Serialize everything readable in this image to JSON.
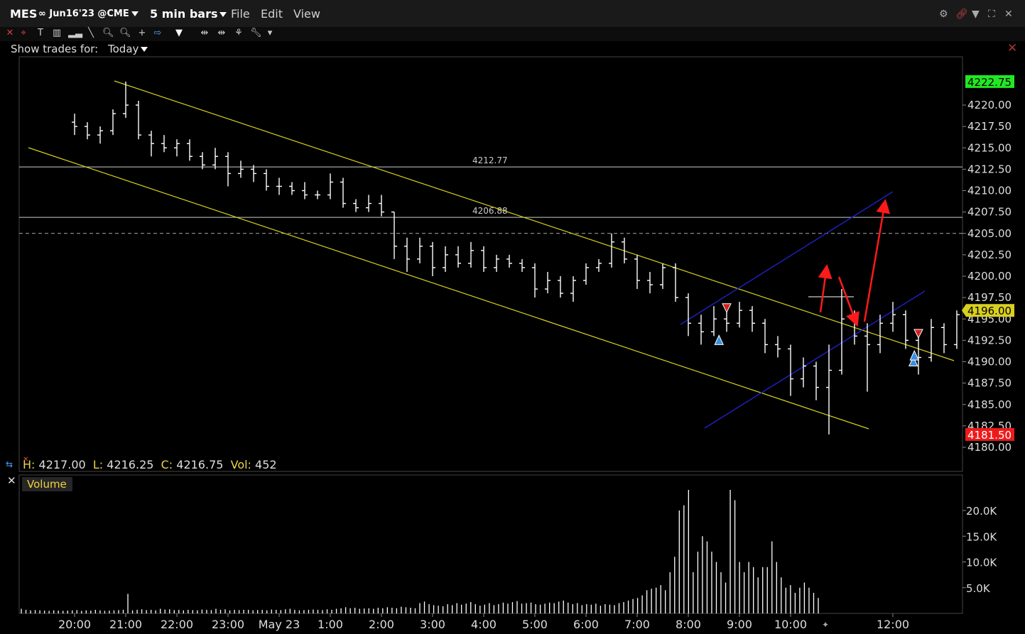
{
  "titlebar": {
    "symbol": "MES",
    "contract": "∞ Jun16'23 @CME",
    "timeframe": "5 min bars",
    "menus": [
      "File",
      "Edit",
      "View"
    ]
  },
  "trades_filter": {
    "label": "Show trades for:",
    "value": "Today"
  },
  "chart_data": [
    {
      "type": "bar",
      "title": "",
      "y_ticks": [
        "4220.00",
        "4217.50",
        "4215.00",
        "4212.50",
        "4210.00",
        "4207.50",
        "4205.00",
        "4202.50",
        "4200.00",
        "4197.50",
        "4195.00",
        "4192.50",
        "4190.00",
        "4187.50",
        "4185.00",
        "4182.50",
        "4180.00"
      ],
      "ylim": [
        4179,
        4224
      ],
      "x_ticks": [
        "20:00",
        "21:00",
        "22:00",
        "23:00",
        "May 23",
        "1:00",
        "2:00",
        "3:00",
        "4:00",
        "5:00",
        "6:00",
        "7:00",
        "8:00",
        "9:00",
        "10:00",
        "12:00"
      ],
      "price_markers": {
        "high": "4222.75",
        "last": "4196.00",
        "low": "4181.50"
      },
      "horizontal_levels": [
        {
          "label": "4212.77",
          "value": 4212.77
        },
        {
          "label": "4206.88",
          "value": 4206.88
        },
        {
          "label": "",
          "value": 4205.0,
          "style": "dashed"
        }
      ],
      "ohlc_readout": {
        "H": "4217.00",
        "L": "4216.25",
        "C": "4216.75",
        "Vol": "452"
      },
      "colors": {
        "bars": "#ffffff",
        "channel_upper": "#d8d020",
        "channel_blue": "#2020c8",
        "arrows": "#ff1a1a",
        "buy": "#3a8fe0",
        "sell": "#d02020",
        "high_bg": "#22e822",
        "low_bg": "#ee1a1a",
        "last_bg": "#d8d020"
      },
      "series": [
        {
          "x": 20.0,
          "o": 4218.0,
          "h": 4219.0,
          "l": 4216.5,
          "c": 4217.5
        },
        {
          "x": 20.25,
          "o": 4217.5,
          "h": 4218.0,
          "l": 4216.0,
          "c": 4216.5
        },
        {
          "x": 20.5,
          "o": 4216.5,
          "h": 4217.5,
          "l": 4215.5,
          "c": 4217.0
        },
        {
          "x": 20.75,
          "o": 4217.0,
          "h": 4219.5,
          "l": 4216.5,
          "c": 4219.0
        },
        {
          "x": 21.0,
          "o": 4219.0,
          "h": 4222.75,
          "l": 4218.5,
          "c": 4220.0
        },
        {
          "x": 21.25,
          "o": 4220.0,
          "h": 4220.5,
          "l": 4216.0,
          "c": 4216.5
        },
        {
          "x": 21.5,
          "o": 4216.5,
          "h": 4217.0,
          "l": 4214.0,
          "c": 4215.5
        },
        {
          "x": 21.75,
          "o": 4215.5,
          "h": 4216.5,
          "l": 4214.5,
          "c": 4215.0
        },
        {
          "x": 22.0,
          "o": 4215.0,
          "h": 4216.0,
          "l": 4214.0,
          "c": 4215.5
        },
        {
          "x": 22.25,
          "o": 4215.5,
          "h": 4216.0,
          "l": 4213.5,
          "c": 4214.0
        },
        {
          "x": 22.5,
          "o": 4214.0,
          "h": 4214.5,
          "l": 4212.5,
          "c": 4213.0
        },
        {
          "x": 22.75,
          "o": 4213.0,
          "h": 4215.0,
          "l": 4212.5,
          "c": 4214.0
        },
        {
          "x": 23.0,
          "o": 4214.0,
          "h": 4214.5,
          "l": 4210.5,
          "c": 4212.0
        },
        {
          "x": 23.25,
          "o": 4212.0,
          "h": 4213.5,
          "l": 4211.5,
          "c": 4212.5
        },
        {
          "x": 23.5,
          "o": 4212.5,
          "h": 4213.0,
          "l": 4211.0,
          "c": 4212.0
        },
        {
          "x": 23.75,
          "o": 4212.0,
          "h": 4212.5,
          "l": 4210.0,
          "c": 4210.5
        },
        {
          "x": 24.0,
          "o": 4210.5,
          "h": 4211.5,
          "l": 4209.5,
          "c": 4210.5
        },
        {
          "x": 24.25,
          "o": 4210.5,
          "h": 4211.0,
          "l": 4209.5,
          "c": 4210.0
        },
        {
          "x": 24.5,
          "o": 4210.0,
          "h": 4211.0,
          "l": 4209.0,
          "c": 4209.5
        },
        {
          "x": 24.75,
          "o": 4209.5,
          "h": 4210.0,
          "l": 4209.0,
          "c": 4209.5
        },
        {
          "x": 25.0,
          "o": 4209.5,
          "h": 4212.0,
          "l": 4209.0,
          "c": 4211.0
        },
        {
          "x": 25.25,
          "o": 4211.0,
          "h": 4211.5,
          "l": 4208.0,
          "c": 4208.5
        },
        {
          "x": 25.5,
          "o": 4208.5,
          "h": 4209.0,
          "l": 4207.5,
          "c": 4208.0
        },
        {
          "x": 25.75,
          "o": 4208.0,
          "h": 4209.5,
          "l": 4207.5,
          "c": 4208.5
        },
        {
          "x": 26.0,
          "o": 4208.5,
          "h": 4209.5,
          "l": 4207.0,
          "c": 4207.5
        },
        {
          "x": 26.25,
          "o": 4207.5,
          "h": 4207.5,
          "l": 4202.0,
          "c": 4203.5
        },
        {
          "x": 26.5,
          "o": 4203.5,
          "h": 4204.5,
          "l": 4200.5,
          "c": 4202.0
        },
        {
          "x": 26.75,
          "o": 4202.0,
          "h": 4204.5,
          "l": 4201.5,
          "c": 4203.5
        },
        {
          "x": 27.0,
          "o": 4203.5,
          "h": 4204.0,
          "l": 4200.0,
          "c": 4201.0
        },
        {
          "x": 27.25,
          "o": 4201.0,
          "h": 4203.5,
          "l": 4200.5,
          "c": 4202.5
        },
        {
          "x": 27.5,
          "o": 4202.5,
          "h": 4203.5,
          "l": 4201.0,
          "c": 4201.5
        },
        {
          "x": 27.75,
          "o": 4201.5,
          "h": 4204.0,
          "l": 4201.0,
          "c": 4203.0
        },
        {
          "x": 28.0,
          "o": 4203.0,
          "h": 4203.5,
          "l": 4200.5,
          "c": 4201.0
        },
        {
          "x": 28.25,
          "o": 4201.0,
          "h": 4202.5,
          "l": 4200.5,
          "c": 4202.0
        },
        {
          "x": 28.5,
          "o": 4202.0,
          "h": 4202.5,
          "l": 4201.0,
          "c": 4201.5
        },
        {
          "x": 28.75,
          "o": 4201.5,
          "h": 4202.0,
          "l": 4200.5,
          "c": 4201.0
        },
        {
          "x": 29.0,
          "o": 4201.0,
          "h": 4201.5,
          "l": 4197.5,
          "c": 4198.5
        },
        {
          "x": 29.25,
          "o": 4198.5,
          "h": 4200.5,
          "l": 4198.0,
          "c": 4199.5
        },
        {
          "x": 29.5,
          "o": 4199.5,
          "h": 4200.0,
          "l": 4197.5,
          "c": 4198.0
        },
        {
          "x": 29.75,
          "o": 4198.0,
          "h": 4200.0,
          "l": 4197.0,
          "c": 4199.5
        },
        {
          "x": 30.0,
          "o": 4199.5,
          "h": 4201.5,
          "l": 4199.0,
          "c": 4201.0
        },
        {
          "x": 30.25,
          "o": 4201.0,
          "h": 4202.0,
          "l": 4200.5,
          "c": 4201.5
        },
        {
          "x": 30.5,
          "o": 4201.5,
          "h": 4205.0,
          "l": 4201.0,
          "c": 4204.0
        },
        {
          "x": 30.75,
          "o": 4204.0,
          "h": 4204.5,
          "l": 4201.5,
          "c": 4202.0
        },
        {
          "x": 31.0,
          "o": 4202.0,
          "h": 4202.5,
          "l": 4198.5,
          "c": 4199.5
        },
        {
          "x": 31.25,
          "o": 4199.5,
          "h": 4200.5,
          "l": 4198.0,
          "c": 4199.0
        },
        {
          "x": 31.5,
          "o": 4199.0,
          "h": 4201.5,
          "l": 4198.5,
          "c": 4201.0
        },
        {
          "x": 31.75,
          "o": 4201.0,
          "h": 4201.5,
          "l": 4197.0,
          "c": 4197.5
        },
        {
          "x": 32.0,
          "o": 4197.5,
          "h": 4198.0,
          "l": 4193.0,
          "c": 4194.5
        },
        {
          "x": 32.25,
          "o": 4194.5,
          "h": 4195.5,
          "l": 4192.0,
          "c": 4193.5
        },
        {
          "x": 32.5,
          "o": 4193.5,
          "h": 4196.5,
          "l": 4193.0,
          "c": 4195.0
        },
        {
          "x": 32.75,
          "o": 4195.0,
          "h": 4196.0,
          "l": 4193.5,
          "c": 4194.5
        },
        {
          "x": 33.0,
          "o": 4194.5,
          "h": 4197.0,
          "l": 4194.0,
          "c": 4196.0
        },
        {
          "x": 33.25,
          "o": 4196.0,
          "h": 4196.5,
          "l": 4193.5,
          "c": 4194.5
        },
        {
          "x": 33.5,
          "o": 4194.5,
          "h": 4195.0,
          "l": 4191.0,
          "c": 4192.0
        },
        {
          "x": 33.75,
          "o": 4192.0,
          "h": 4193.0,
          "l": 4190.5,
          "c": 4191.5
        },
        {
          "x": 34.0,
          "o": 4191.5,
          "h": 4192.0,
          "l": 4186.0,
          "c": 4188.0
        },
        {
          "x": 34.25,
          "o": 4188.0,
          "h": 4190.5,
          "l": 4187.0,
          "c": 4189.5
        },
        {
          "x": 34.5,
          "o": 4189.5,
          "h": 4190.0,
          "l": 4185.5,
          "c": 4187.0
        },
        {
          "x": 34.75,
          "o": 4187.0,
          "h": 4192.0,
          "l": 4181.5,
          "c": 4189.0
        },
        {
          "x": 35.0,
          "o": 4189.0,
          "h": 4198.5,
          "l": 4188.5,
          "c": 4195.0
        },
        {
          "x": 35.25,
          "o": 4195.0,
          "h": 4196.0,
          "l": 4192.0,
          "c": 4193.0
        },
        {
          "x": 35.5,
          "o": 4193.0,
          "h": 4194.5,
          "l": 4186.5,
          "c": 4192.0
        },
        {
          "x": 35.75,
          "o": 4192.0,
          "h": 4195.5,
          "l": 4191.0,
          "c": 4194.5
        },
        {
          "x": 36.0,
          "o": 4194.5,
          "h": 4197.0,
          "l": 4193.5,
          "c": 4195.5
        },
        {
          "x": 36.25,
          "o": 4195.5,
          "h": 4196.0,
          "l": 4191.5,
          "c": 4192.5
        },
        {
          "x": 36.5,
          "o": 4192.5,
          "h": 4193.0,
          "l": 4188.5,
          "c": 4190.5
        },
        {
          "x": 36.75,
          "o": 4190.5,
          "h": 4195.0,
          "l": 4190.0,
          "c": 4194.0
        },
        {
          "x": 37.0,
          "o": 4194.0,
          "h": 4194.5,
          "l": 4191.0,
          "c": 4192.0
        },
        {
          "x": 37.25,
          "o": 4192.0,
          "h": 4196.0,
          "l": 4191.5,
          "c": 4195.5
        },
        {
          "x": 37.5,
          "o": 4195.5,
          "h": 4196.5,
          "l": 4195.0,
          "c": 4196.0
        }
      ],
      "trade_markers": [
        {
          "side": "sell",
          "x": 32.75,
          "price": 4196.2
        },
        {
          "side": "buy",
          "x": 32.6,
          "price": 4192.5
        },
        {
          "side": "sell",
          "x": 36.5,
          "price": 4193.2
        },
        {
          "side": "buy",
          "x": 36.4,
          "price": 4190.0
        },
        {
          "side": "buy",
          "x": 36.42,
          "price": 4190.7
        }
      ]
    },
    {
      "type": "bar",
      "title": "Volume",
      "y_ticks": [
        "20.0K",
        "15.0K",
        "10.0K",
        "5.0K"
      ],
      "ylim": [
        0,
        24000
      ],
      "values": [
        900,
        700,
        600,
        650,
        600,
        550,
        500,
        600,
        550,
        500,
        550,
        600,
        650,
        500,
        600,
        550,
        700,
        600,
        500,
        550,
        600,
        650,
        700,
        3800,
        600,
        700,
        800,
        650,
        700,
        600,
        900,
        750,
        800,
        650,
        700,
        600,
        700,
        650,
        600,
        750,
        700,
        650,
        900,
        700,
        800,
        600,
        700,
        650,
        700,
        700,
        600,
        650,
        700,
        600,
        750,
        700,
        650,
        800,
        900,
        700,
        600,
        650,
        700,
        750,
        700,
        650,
        800,
        700,
        900,
        1000,
        1200,
        1000,
        1100,
        900,
        950,
        1000,
        900,
        1100,
        1000,
        1200,
        1100,
        1000,
        1300,
        1200,
        1100,
        1000,
        2000,
        2300,
        1800,
        1600,
        1500,
        1400,
        1800,
        1600,
        2000,
        1700,
        1900,
        2200,
        1800,
        1500,
        1700,
        2000,
        1600,
        1800,
        2100,
        1900,
        2200,
        2400,
        1900,
        2000,
        2100,
        1800,
        1700,
        1900,
        2100,
        2000,
        2300,
        2500,
        2100,
        1800,
        2000,
        1600,
        1800,
        1700,
        1900,
        1500,
        1800,
        1700,
        1600,
        2000,
        2200,
        2500,
        2800,
        3000,
        3500,
        4500,
        4800,
        5000,
        5500,
        4500,
        8000,
        11000,
        20000,
        21000,
        24000,
        8000,
        12000,
        15000,
        14000,
        12000,
        10000,
        8000,
        6000,
        24000,
        22000,
        10000,
        8000,
        10000,
        9000,
        7000,
        9000,
        9000,
        14000,
        10000,
        7000,
        5000,
        5500,
        4000,
        5000,
        6000,
        5000,
        4000,
        3000
      ]
    }
  ]
}
